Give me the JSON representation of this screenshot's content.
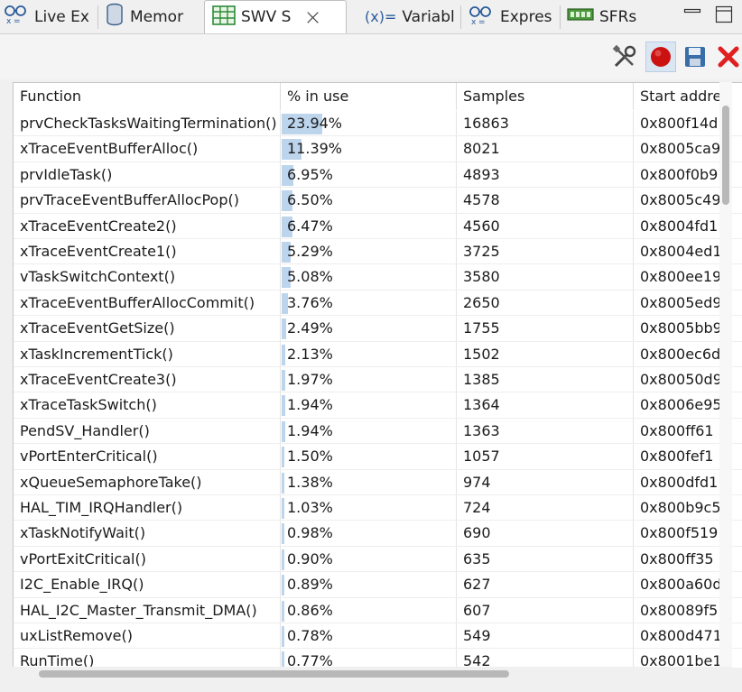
{
  "tabs": [
    {
      "label": "Live Ex",
      "icon": "live-expressions-icon",
      "active": false
    },
    {
      "label": "Memor",
      "icon": "memory-icon",
      "active": false
    },
    {
      "label": "SWV S",
      "icon": "table-icon",
      "active": true
    },
    {
      "label": "Variabl",
      "icon": "variables-icon",
      "prefix": "(x)=",
      "active": false
    },
    {
      "label": "Expres",
      "icon": "expressions-icon",
      "active": false
    },
    {
      "label": "SFRs",
      "icon": "sfrs-icon",
      "active": false
    }
  ],
  "toolbar": {
    "buttons": [
      "configure-trace-icon",
      "start-trace-icon",
      "save-icon",
      "remove-icon"
    ],
    "colors": {
      "record": "#cc1111",
      "remove": "#e02020",
      "save": "#3a6ea8"
    }
  },
  "table": {
    "columns": [
      "Function",
      "% in use",
      "Samples",
      "Start addre"
    ],
    "rows": [
      {
        "function": "prvCheckTasksWaitingTermination()",
        "pct": "23.94%",
        "pct_value": 23.94,
        "samples": "16863",
        "address": "0x800f14d"
      },
      {
        "function": "xTraceEventBufferAlloc()",
        "pct": "11.39%",
        "pct_value": 11.39,
        "samples": "8021",
        "address": "0x8005ca9"
      },
      {
        "function": "prvIdleTask()",
        "pct": "6.95%",
        "pct_value": 6.95,
        "samples": "4893",
        "address": "0x800f0b9"
      },
      {
        "function": "prvTraceEventBufferAllocPop()",
        "pct": "6.50%",
        "pct_value": 6.5,
        "samples": "4578",
        "address": "0x8005c49"
      },
      {
        "function": "xTraceEventCreate2()",
        "pct": "6.47%",
        "pct_value": 6.47,
        "samples": "4560",
        "address": "0x8004fd1"
      },
      {
        "function": "xTraceEventCreate1()",
        "pct": "5.29%",
        "pct_value": 5.29,
        "samples": "3725",
        "address": "0x8004ed1"
      },
      {
        "function": "vTaskSwitchContext()",
        "pct": "5.08%",
        "pct_value": 5.08,
        "samples": "3580",
        "address": "0x800ee19"
      },
      {
        "function": "xTraceEventBufferAllocCommit()",
        "pct": "3.76%",
        "pct_value": 3.76,
        "samples": "2650",
        "address": "0x8005ed9"
      },
      {
        "function": "xTraceEventGetSize()",
        "pct": "2.49%",
        "pct_value": 2.49,
        "samples": "1755",
        "address": "0x8005bb9"
      },
      {
        "function": "xTaskIncrementTick()",
        "pct": "2.13%",
        "pct_value": 2.13,
        "samples": "1502",
        "address": "0x800ec6d"
      },
      {
        "function": "xTraceEventCreate3()",
        "pct": "1.97%",
        "pct_value": 1.97,
        "samples": "1385",
        "address": "0x80050d9"
      },
      {
        "function": "xTraceTaskSwitch()",
        "pct": "1.94%",
        "pct_value": 1.94,
        "samples": "1364",
        "address": "0x8006e95"
      },
      {
        "function": "PendSV_Handler()",
        "pct": "1.94%",
        "pct_value": 1.94,
        "samples": "1363",
        "address": "0x800ff61"
      },
      {
        "function": "vPortEnterCritical()",
        "pct": "1.50%",
        "pct_value": 1.5,
        "samples": "1057",
        "address": "0x800fef1"
      },
      {
        "function": "xQueueSemaphoreTake()",
        "pct": "1.38%",
        "pct_value": 1.38,
        "samples": "974",
        "address": "0x800dfd1"
      },
      {
        "function": "HAL_TIM_IRQHandler()",
        "pct": "1.03%",
        "pct_value": 1.03,
        "samples": "724",
        "address": "0x800b9c5"
      },
      {
        "function": "xTaskNotifyWait()",
        "pct": "0.98%",
        "pct_value": 0.98,
        "samples": "690",
        "address": "0x800f519"
      },
      {
        "function": "vPortExitCritical()",
        "pct": "0.90%",
        "pct_value": 0.9,
        "samples": "635",
        "address": "0x800ff35"
      },
      {
        "function": "I2C_Enable_IRQ()",
        "pct": "0.89%",
        "pct_value": 0.89,
        "samples": "627",
        "address": "0x800a60d"
      },
      {
        "function": "HAL_I2C_Master_Transmit_DMA()",
        "pct": "0.86%",
        "pct_value": 0.86,
        "samples": "607",
        "address": "0x80089f5"
      },
      {
        "function": "uxListRemove()",
        "pct": "0.78%",
        "pct_value": 0.78,
        "samples": "549",
        "address": "0x800d471"
      },
      {
        "function": "RunTime()",
        "pct": "0.77%",
        "pct_value": 0.77,
        "samples": "542",
        "address": "0x8001be1"
      }
    ]
  },
  "colors": {
    "usage_bar": "#bcd4ec"
  }
}
